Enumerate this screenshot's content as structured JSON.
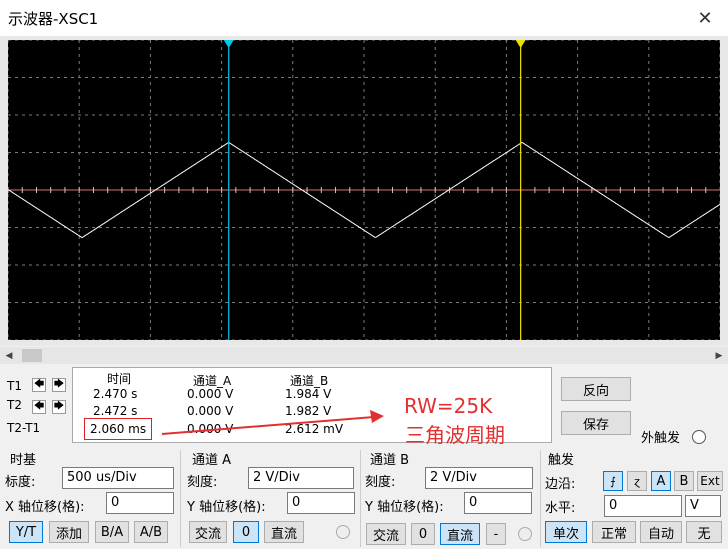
{
  "window": {
    "title": "示波器-XSC1",
    "close_glyph": "✕"
  },
  "colors": {
    "trace": "#ffffff",
    "cursor1": "#00c8e8",
    "cursor2": "#f0e000",
    "grid": "#7a7a7a",
    "axis": "#e07070",
    "annotation": "#e23030"
  },
  "scroll": {
    "left_glyph": "◀",
    "right_glyph": "▶"
  },
  "cursors": {
    "t1": "T1",
    "t2": "T2",
    "t2t1": "T2-T1",
    "left_glyph": "🡄",
    "right_glyph": "🡆",
    "cursor1_pos": 0.31,
    "cursor2_pos": 0.72
  },
  "readout": {
    "headers": {
      "time": "时间",
      "ch_a": "通道_A",
      "ch_b": "通道_B"
    },
    "rows": [
      {
        "time": "2.470 s",
        "a": "0.000 V",
        "b": "1.984 V"
      },
      {
        "time": "2.472 s",
        "a": "0.000 V",
        "b": "1.982 V"
      },
      {
        "time": "2.060 ms",
        "a": "0.000 V",
        "b": "2.612 mV"
      }
    ]
  },
  "annotation": {
    "line1": "RW=25K",
    "line2": "三角波周期"
  },
  "actions": {
    "reverse": "反向",
    "save": "保存",
    "ext_trigger": "外触发"
  },
  "timebase": {
    "title": "时基",
    "scale_label": "标度:",
    "scale": "500 us/Div",
    "xpos_label": "X 轴位移(格):",
    "xpos": "0",
    "modes": [
      "Y/T",
      "添加",
      "B/A",
      "A/B"
    ]
  },
  "channel_a": {
    "title": "通道 A",
    "scale_label": "刻度:",
    "scale": "2  V/Div",
    "ypos_label": "Y 轴位移(格):",
    "ypos": "0",
    "coupling": [
      "交流",
      "0",
      "直流"
    ]
  },
  "channel_b": {
    "title": "通道 B",
    "scale_label": "刻度:",
    "scale": "2  V/Div",
    "ypos_label": "Y 轴位移(格):",
    "ypos": "0",
    "coupling": [
      "交流",
      "0",
      "直流",
      "-"
    ]
  },
  "trigger": {
    "title": "触发",
    "edge_label": "边沿:",
    "edge_rise": "⨍",
    "edge_fall": "ɀ",
    "sources": [
      "A",
      "B",
      "Ext"
    ],
    "level_label": "水平:",
    "level": "0",
    "level_unit": "V",
    "modes": [
      "单次",
      "正常",
      "自动",
      "无"
    ]
  }
}
